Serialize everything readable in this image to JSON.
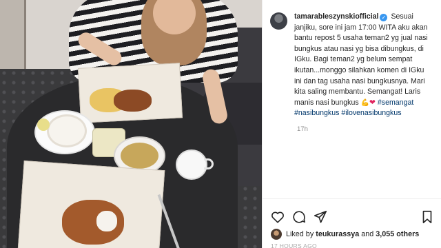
{
  "post": {
    "username": "tamarableszynskiofficial",
    "verified_badge": "✓",
    "caption_text": "Sesuai janjiku, sore ini jam 17:00 WITA aku akan bantu repost 5 usaha teman2 yg jual nasi bungkus atau nasi yg bisa dibungkus, di IGku. Bagi teman2 yg belum sempat ikutan...monggo silahkan komen di IGku ini dan tag usaha nasi bungkusnya. Mari kita saling membantu. Semangat! Laris manis nasi bungkus",
    "emoji_muscle": "💪",
    "emoji_heart": "❤",
    "hashtag_1": "#semangat",
    "hashtag_2": "#nasibungkus",
    "hashtag_3": "#ilovenasibungkus",
    "comment_time": "17h"
  },
  "actions": {
    "like_icon": "heart-icon",
    "comment_icon": "comment-icon",
    "share_icon": "share-icon",
    "save_icon": "bookmark-icon"
  },
  "likes": {
    "prefix": "Liked by ",
    "user": "teukurassya",
    "middle": " and ",
    "count": "3,055 others"
  },
  "posted_ago": "17 HOURS AGO",
  "colors": {
    "verified": "#3897f0",
    "hashtag": "#00376b",
    "heart": "#e0245e"
  }
}
